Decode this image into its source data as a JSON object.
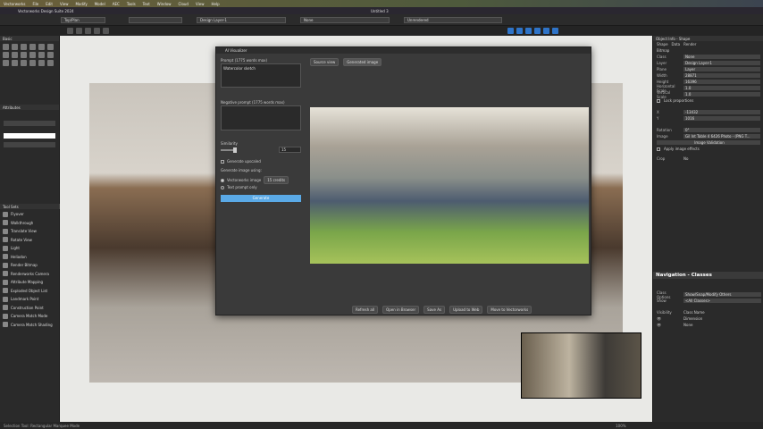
{
  "menubar": {
    "items": [
      "Vectorworks",
      "File",
      "Edit",
      "View",
      "Modify",
      "Model",
      "AEC",
      "Tools",
      "Text",
      "Window",
      "Cloud",
      "View",
      "Help"
    ]
  },
  "titlebar": {
    "app_title": "Vectorworks Design Suite 2024",
    "document": "Untitled 3"
  },
  "toolbar": {
    "view": "Top/Plan",
    "layer": "Design Layer-1",
    "class": "None",
    "render_mode": "Unrendered"
  },
  "left_panel": {
    "basic_title": "Basic",
    "attributes_title": "Attributes",
    "toolsets_title": "Tool Sets",
    "tools": [
      "Flyover",
      "Walkthrough",
      "Translate View",
      "Rotate View",
      "Light",
      "Heliodon",
      "Render Bitmap",
      "Renderworks Camera",
      "Attribute Mapping",
      "Exploded Object List",
      "Landmark Point",
      "Construction Point",
      "Camera Match Mode",
      "Camera Match Shading"
    ]
  },
  "dialog": {
    "title": "AI Visualizer",
    "prompt_label": "Prompt (1775 words max)",
    "prompt_value": "Watercolor sketch",
    "negative_label": "Negative prompt (1775 words max)",
    "similarity_label": "Similarity",
    "similarity_value": "15",
    "upscale_label": "Generate upscaled",
    "generate_using_label": "Generate image using:",
    "option_vw": "Vectorworks image",
    "option_vw_credits": "15 credits",
    "option_text": "Text prompt only",
    "generate_button": "Generate",
    "tabs": [
      "Source view",
      "Generated image"
    ],
    "bottom_buttons": [
      "Refresh all",
      "Open in Browser",
      "Save As",
      "Upload to Web",
      "Move to Vectorworks"
    ]
  },
  "object_info": {
    "title": "Object Info - Shape",
    "tabs": [
      "Shape",
      "Data",
      "Render"
    ],
    "object_type": "Bitmap",
    "fields": [
      {
        "k": "Class",
        "v": "None"
      },
      {
        "k": "Layer",
        "v": "Design Layer-1"
      },
      {
        "k": "Plane",
        "v": "Layer"
      },
      {
        "k": "Width",
        "v": "28871"
      },
      {
        "k": "Height",
        "v": "16396"
      },
      {
        "k": "Horizontal Scale",
        "v": "1.0"
      },
      {
        "k": "Vertical Scale",
        "v": "1.0"
      }
    ],
    "lock_label": "Lock proportions",
    "x": "-13432",
    "y": "1016",
    "rotation_label": "Rotation",
    "rotation": "0°",
    "image_label": "Image",
    "image": "Gil Int Table 4 6426 Photo - (PNG T...",
    "image_button": "Image Validation",
    "effects_label": "Apply image effects",
    "crop_label": "Crop",
    "crop": "No"
  },
  "navigation": {
    "title": "Navigation - Classes",
    "class_options_label": "Class Options",
    "class_options": "Show/Snap/Modify Others",
    "show_label": "Show",
    "show": "<All Classes>",
    "col_visibility": "Visibility",
    "col_name": "Class Name",
    "classes": [
      "Dimension",
      "None"
    ]
  },
  "status": {
    "left": "Selection Tool: Rectangular Marquee Mode",
    "zoom": "100%"
  }
}
